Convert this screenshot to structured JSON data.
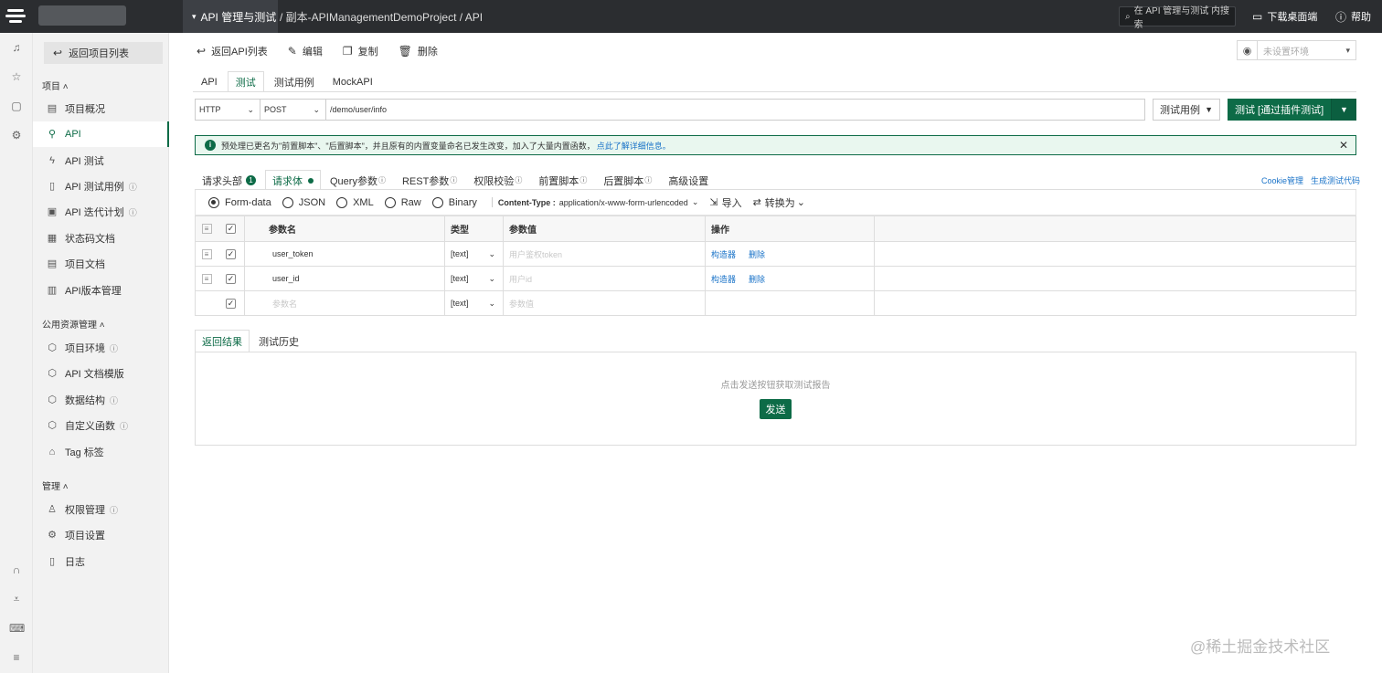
{
  "topbar": {
    "project_menu": "API 管理与测试",
    "breadcrumb": "/ 副本-APIManagementDemoProject / API",
    "search_placeholder": "在 API 管理与测试 内搜索",
    "download": "下载桌面端",
    "help": "帮助"
  },
  "nav": {
    "back": "返回项目列表",
    "section_project": "项目 ˄",
    "section_public": "公用资源管理 ˄",
    "section_manage": "管理 ˄",
    "items": [
      {
        "label": "项目概况"
      },
      {
        "label": "API"
      },
      {
        "label": "API 测试"
      },
      {
        "label": "API 测试用例"
      },
      {
        "label": "API 迭代计划"
      },
      {
        "label": "状态码文档"
      },
      {
        "label": "项目文档"
      },
      {
        "label": "API版本管理"
      },
      {
        "label": "项目环境"
      },
      {
        "label": "API 文档模版"
      },
      {
        "label": "数据结构"
      },
      {
        "label": "自定义函数"
      },
      {
        "label": "Tag 标签"
      },
      {
        "label": "权限管理"
      },
      {
        "label": "项目设置"
      },
      {
        "label": "日志"
      }
    ]
  },
  "toolbar": {
    "back": "返回API列表",
    "edit": "编辑",
    "copy": "复制",
    "delete": "删除",
    "env_placeholder": "未设置环境"
  },
  "tabs": [
    "API",
    "测试",
    "测试用例",
    "MockAPI"
  ],
  "request": {
    "protocol": "HTTP",
    "method": "POST",
    "url": "/demo/user/info",
    "case_select": "测试用例",
    "run_button": "测试 [通过插件测试]"
  },
  "notice": {
    "text": "预处理已更名为\"前置脚本\"、\"后置脚本\"，并且原有的内置变量命名已发生改变，加入了大量内置函数，",
    "link": "点此了解详细信息。"
  },
  "req_tabs": {
    "headers": "请求头部",
    "headers_count": "1",
    "body": "请求体",
    "query": "Query参数",
    "rest": "REST参数",
    "auth": "权限校验",
    "pre": "前置脚本",
    "post": "后置脚本",
    "advanced": "高级设置",
    "cookie": "Cookie管理",
    "gen_code": "生成测试代码"
  },
  "body_opts": {
    "formdata": "Form-data",
    "json": "JSON",
    "xml": "XML",
    "raw": "Raw",
    "binary": "Binary",
    "ct_label": "Content-Type :",
    "ct_value": "application/x-www-form-urlencoded",
    "import": "导入",
    "convert": "转换为"
  },
  "params": {
    "headers": {
      "name": "参数名",
      "type": "类型",
      "value": "参数值",
      "ops": "操作"
    },
    "rows": [
      {
        "name": "user_token",
        "type": "[text]",
        "value": "用户鉴权token",
        "builder": "构造器",
        "del": "删除"
      },
      {
        "name": "user_id",
        "type": "[text]",
        "value": "用户id",
        "builder": "构造器",
        "del": "删除"
      },
      {
        "name": "参数名",
        "type": "[text]",
        "value": "参数值",
        "builder": "",
        "del": ""
      }
    ]
  },
  "response": {
    "tab_result": "返回结果",
    "tab_history": "测试历史",
    "hint": "点击发送按钮获取测试报告",
    "send": "发送"
  },
  "watermark": "@稀土掘金技术社区"
}
